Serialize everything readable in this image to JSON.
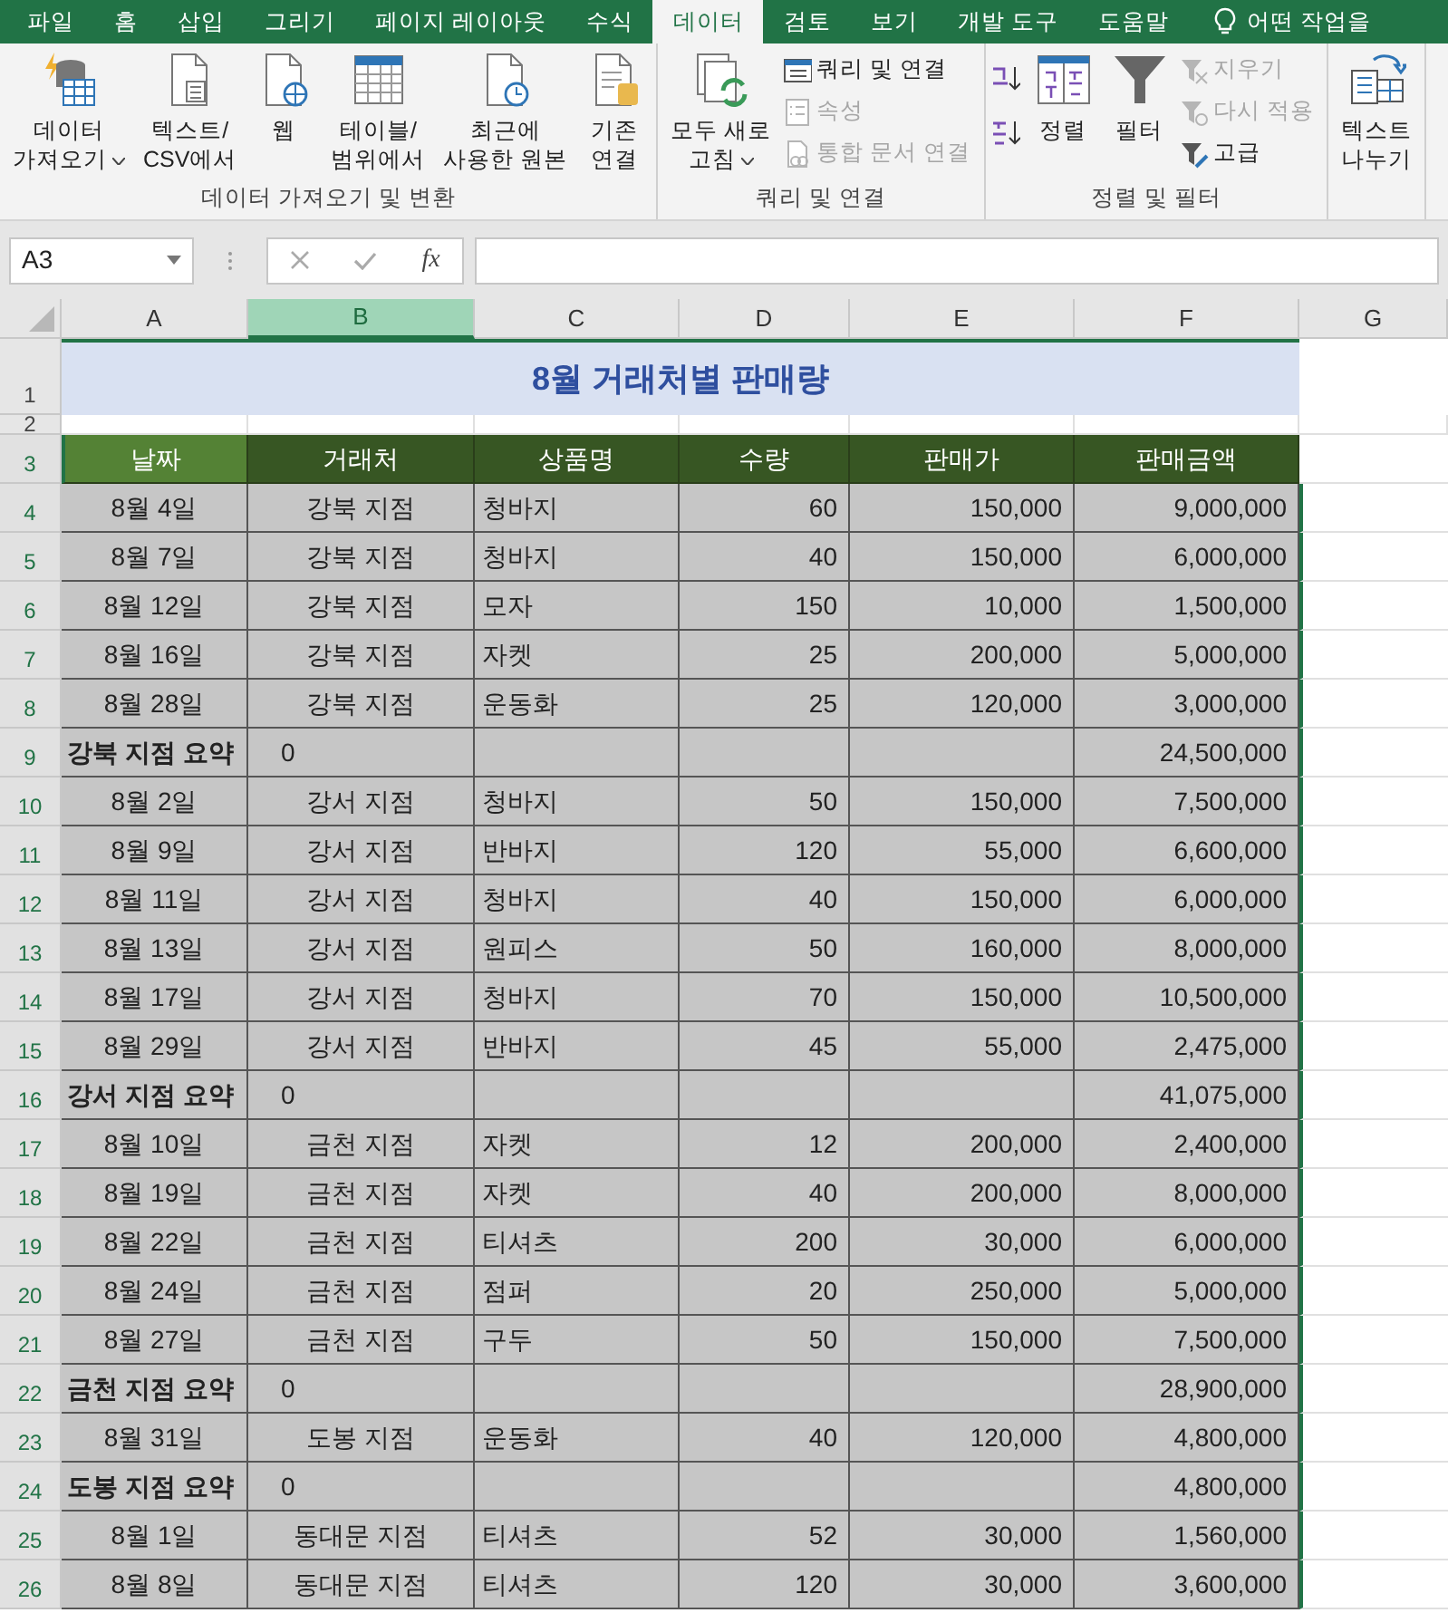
{
  "tabs": [
    {
      "label": "파일",
      "selected": false
    },
    {
      "label": "홈",
      "selected": false
    },
    {
      "label": "삽입",
      "selected": false
    },
    {
      "label": "그리기",
      "selected": false
    },
    {
      "label": "페이지 레이아웃",
      "selected": false
    },
    {
      "label": "수식",
      "selected": false
    },
    {
      "label": "데이터",
      "selected": true
    },
    {
      "label": "검토",
      "selected": false
    },
    {
      "label": "보기",
      "selected": false
    },
    {
      "label": "개발 도구",
      "selected": false
    },
    {
      "label": "도움말",
      "selected": false
    }
  ],
  "tell_me": "어떤 작업을",
  "ribbon_groups": [
    {
      "label": "데이터 가져오기 및 변환",
      "buttons": [
        {
          "kind": "large",
          "label": "데이터\n가져오기",
          "dropdown": true
        },
        {
          "kind": "large",
          "label": "텍스트/\nCSV에서",
          "dropdown": false
        },
        {
          "kind": "large",
          "label": "웹",
          "dropdown": false
        },
        {
          "kind": "large",
          "label": "테이블/\n범위에서",
          "dropdown": false
        },
        {
          "kind": "large",
          "label": "최근에\n사용한 원본",
          "dropdown": false
        },
        {
          "kind": "large",
          "label": "기존\n연결",
          "dropdown": false
        }
      ]
    },
    {
      "label": "쿼리 및 연결",
      "buttons": [
        {
          "kind": "large",
          "label": "모두 새로\n고침",
          "dropdown": true
        },
        {
          "kind": "small",
          "label": "쿼리 및 연결",
          "disabled": false
        },
        {
          "kind": "small",
          "label": "속성",
          "disabled": true
        },
        {
          "kind": "small",
          "label": "통합 문서 연결",
          "disabled": true
        }
      ]
    },
    {
      "label": "정렬 및 필터",
      "buttons": [
        {
          "kind": "sortpair"
        },
        {
          "kind": "large",
          "label": "정렬",
          "dropdown": false
        },
        {
          "kind": "large",
          "label": "필터",
          "dropdown": false
        },
        {
          "kind": "small",
          "label": "지우기",
          "disabled": true
        },
        {
          "kind": "small",
          "label": "다시 적용",
          "disabled": true
        },
        {
          "kind": "small",
          "label": "고급",
          "disabled": false
        }
      ]
    },
    {
      "buttons": [
        {
          "kind": "large",
          "label": "텍스트\n나누기",
          "dropdown": false
        }
      ]
    }
  ],
  "name_box": "A3",
  "fx": "fx",
  "columns": [
    {
      "label": "A",
      "selected": false
    },
    {
      "label": "B",
      "selected": true
    },
    {
      "label": "C",
      "selected": false
    },
    {
      "label": "D",
      "selected": false
    },
    {
      "label": "E",
      "selected": false
    },
    {
      "label": "F",
      "selected": false
    },
    {
      "label": "G",
      "selected": false
    }
  ],
  "title": {
    "row": "1",
    "text": "8월 거래처별 판매량"
  },
  "blank_row": "2",
  "header": {
    "row": "3",
    "cells": [
      {
        "text": "날짜",
        "selected": true
      },
      {
        "text": "거래처",
        "selected": false
      },
      {
        "text": "상품명",
        "selected": false
      },
      {
        "text": "수량",
        "selected": false
      },
      {
        "text": "판매가",
        "selected": false
      },
      {
        "text": "판매금액",
        "selected": false
      }
    ]
  },
  "rows": [
    {
      "row": "4",
      "kind": "data",
      "cells": [
        "8월 4일",
        "강북 지점",
        "청바지",
        "60",
        "150,000",
        "9,000,000"
      ]
    },
    {
      "row": "5",
      "kind": "data",
      "cells": [
        "8월 7일",
        "강북 지점",
        "청바지",
        "40",
        "150,000",
        "6,000,000"
      ]
    },
    {
      "row": "6",
      "kind": "data",
      "cells": [
        "8월 12일",
        "강북 지점",
        "모자",
        "150",
        "10,000",
        "1,500,000"
      ]
    },
    {
      "row": "7",
      "kind": "data",
      "cells": [
        "8월 16일",
        "강북 지점",
        "자켓",
        "25",
        "200,000",
        "5,000,000"
      ]
    },
    {
      "row": "8",
      "kind": "data",
      "cells": [
        "8월 28일",
        "강북 지점",
        "운동화",
        "25",
        "120,000",
        "3,000,000"
      ]
    },
    {
      "row": "9",
      "kind": "subtotal",
      "cells": [
        "강북 지점 요약",
        "0",
        "",
        "",
        "",
        "24,500,000"
      ]
    },
    {
      "row": "10",
      "kind": "data",
      "cells": [
        "8월 2일",
        "강서 지점",
        "청바지",
        "50",
        "150,000",
        "7,500,000"
      ]
    },
    {
      "row": "11",
      "kind": "data",
      "cells": [
        "8월 9일",
        "강서 지점",
        "반바지",
        "120",
        "55,000",
        "6,600,000"
      ]
    },
    {
      "row": "12",
      "kind": "data",
      "cells": [
        "8월 11일",
        "강서 지점",
        "청바지",
        "40",
        "150,000",
        "6,000,000"
      ]
    },
    {
      "row": "13",
      "kind": "data",
      "cells": [
        "8월 13일",
        "강서 지점",
        "원피스",
        "50",
        "160,000",
        "8,000,000"
      ]
    },
    {
      "row": "14",
      "kind": "data",
      "cells": [
        "8월 17일",
        "강서 지점",
        "청바지",
        "70",
        "150,000",
        "10,500,000"
      ]
    },
    {
      "row": "15",
      "kind": "data",
      "cells": [
        "8월 29일",
        "강서 지점",
        "반바지",
        "45",
        "55,000",
        "2,475,000"
      ]
    },
    {
      "row": "16",
      "kind": "subtotal",
      "cells": [
        "강서 지점 요약",
        "0",
        "",
        "",
        "",
        "41,075,000"
      ]
    },
    {
      "row": "17",
      "kind": "data",
      "cells": [
        "8월 10일",
        "금천 지점",
        "자켓",
        "12",
        "200,000",
        "2,400,000"
      ]
    },
    {
      "row": "18",
      "kind": "data",
      "cells": [
        "8월 19일",
        "금천 지점",
        "자켓",
        "40",
        "200,000",
        "8,000,000"
      ]
    },
    {
      "row": "19",
      "kind": "data",
      "cells": [
        "8월 22일",
        "금천 지점",
        "티셔츠",
        "200",
        "30,000",
        "6,000,000"
      ]
    },
    {
      "row": "20",
      "kind": "data",
      "cells": [
        "8월 24일",
        "금천 지점",
        "점퍼",
        "20",
        "250,000",
        "5,000,000"
      ]
    },
    {
      "row": "21",
      "kind": "data",
      "cells": [
        "8월 27일",
        "금천 지점",
        "구두",
        "50",
        "150,000",
        "7,500,000"
      ]
    },
    {
      "row": "22",
      "kind": "subtotal",
      "cells": [
        "금천 지점 요약",
        "0",
        "",
        "",
        "",
        "28,900,000"
      ]
    },
    {
      "row": "23",
      "kind": "data",
      "cells": [
        "8월 31일",
        "도봉 지점",
        "운동화",
        "40",
        "120,000",
        "4,800,000"
      ]
    },
    {
      "row": "24",
      "kind": "subtotal",
      "cells": [
        "도봉 지점 요약",
        "0",
        "",
        "",
        "",
        "4,800,000"
      ]
    },
    {
      "row": "25",
      "kind": "data",
      "cells": [
        "8월 1일",
        "동대문 지점",
        "티셔츠",
        "52",
        "30,000",
        "1,560,000"
      ]
    },
    {
      "row": "26",
      "kind": "data",
      "cells": [
        "8월 8일",
        "동대문 지점",
        "티셔츠",
        "120",
        "30,000",
        "3,600,000"
      ]
    }
  ]
}
